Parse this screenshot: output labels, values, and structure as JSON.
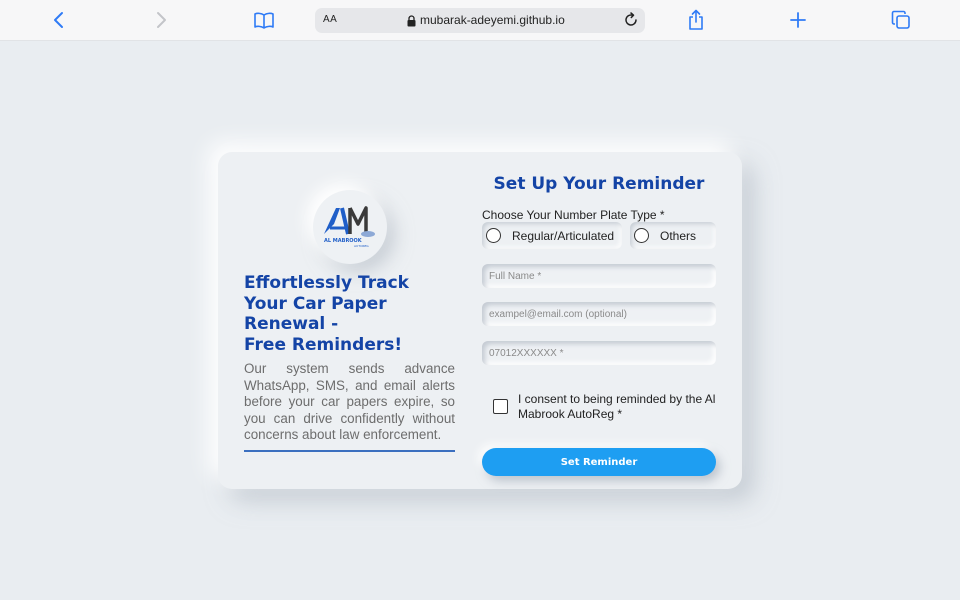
{
  "browser": {
    "address_aa": "AA",
    "url": "mubarak-adeyemi.github.io",
    "colors": {
      "accent": "#2f7bf6",
      "disabled": "#c3c5c9"
    },
    "icons": [
      "back-icon",
      "forward-icon",
      "bookmarks-icon",
      "lock-icon",
      "reload-icon",
      "share-icon",
      "new-tab-icon",
      "tabs-icon"
    ]
  },
  "left": {
    "logo_alt": "Al Mabrook AutoReg",
    "logo_text_big": "AM",
    "logo_text_small": "AL MABROOK",
    "logo_text_tiny": "AUTOREG",
    "headline_lines": [
      "Effortlessly Track",
      "Your Car Paper",
      "Renewal -",
      "Free Reminders!"
    ],
    "description": "Our system sends advance WhatsApp, SMS, and email alerts before your car papers expire, so you can drive confidently without concerns about law enforcement."
  },
  "form": {
    "title": "Set Up Your Reminder",
    "plate_label": "Choose Your Number Plate Type *",
    "plate_options": [
      "Regular/Articulated",
      "Others"
    ],
    "fullname_placeholder": "Full Name *",
    "email_placeholder": "exampel@email.com (optional)",
    "phone_placeholder": "07012XXXXXX *",
    "consent_text": "I consent to being reminded by the Al Mabrook AutoReg *",
    "submit_label": "Set Reminder"
  },
  "colors": {
    "brand": "#1444a6",
    "button": "#1e9ef2",
    "background": "#e9edf1"
  }
}
